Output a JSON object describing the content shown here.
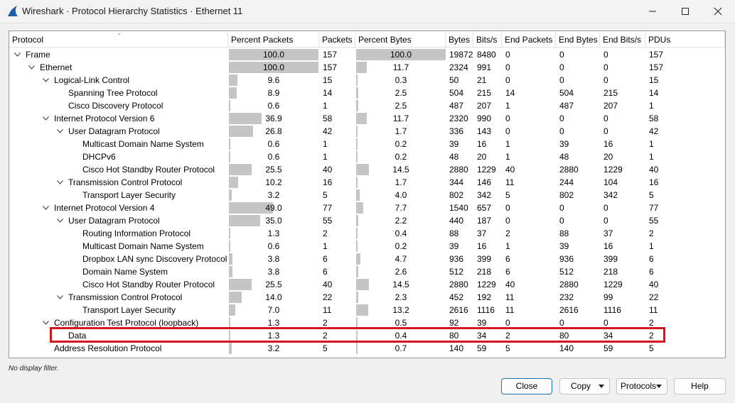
{
  "window": {
    "title": "Wireshark · Protocol Hierarchy Statistics · Ethernet 11",
    "icon": "wireshark-fin-icon",
    "controls": [
      "minimize-icon",
      "maximize-icon",
      "close-icon"
    ]
  },
  "table": {
    "columns": [
      "Protocol",
      "Percent Packets",
      "Packets",
      "Percent Bytes",
      "Bytes",
      "Bits/s",
      "End Packets",
      "End Bytes",
      "End Bits/s",
      "PDUs"
    ],
    "rows": [
      {
        "level": 0,
        "expandable": true,
        "name": "Frame",
        "pct_packets": "100.0",
        "packets": "157",
        "pct_bytes": "100.0",
        "bytes": "19872",
        "bits": "8480",
        "end_packets": "0",
        "end_bytes": "0",
        "end_bits": "0",
        "pdus": "157"
      },
      {
        "level": 1,
        "expandable": true,
        "name": "Ethernet",
        "pct_packets": "100.0",
        "packets": "157",
        "pct_bytes": "11.7",
        "bytes": "2324",
        "bits": "991",
        "end_packets": "0",
        "end_bytes": "0",
        "end_bits": "0",
        "pdus": "157"
      },
      {
        "level": 2,
        "expandable": true,
        "name": "Logical-Link Control",
        "pct_packets": "9.6",
        "packets": "15",
        "pct_bytes": "0.3",
        "bytes": "50",
        "bits": "21",
        "end_packets": "0",
        "end_bytes": "0",
        "end_bits": "0",
        "pdus": "15"
      },
      {
        "level": 3,
        "expandable": false,
        "name": "Spanning Tree Protocol",
        "pct_packets": "8.9",
        "packets": "14",
        "pct_bytes": "2.5",
        "bytes": "504",
        "bits": "215",
        "end_packets": "14",
        "end_bytes": "504",
        "end_bits": "215",
        "pdus": "14"
      },
      {
        "level": 3,
        "expandable": false,
        "name": "Cisco Discovery Protocol",
        "pct_packets": "0.6",
        "packets": "1",
        "pct_bytes": "2.5",
        "bytes": "487",
        "bits": "207",
        "end_packets": "1",
        "end_bytes": "487",
        "end_bits": "207",
        "pdus": "1"
      },
      {
        "level": 2,
        "expandable": true,
        "name": "Internet Protocol Version 6",
        "pct_packets": "36.9",
        "packets": "58",
        "pct_bytes": "11.7",
        "bytes": "2320",
        "bits": "990",
        "end_packets": "0",
        "end_bytes": "0",
        "end_bits": "0",
        "pdus": "58"
      },
      {
        "level": 3,
        "expandable": true,
        "name": "User Datagram Protocol",
        "pct_packets": "26.8",
        "packets": "42",
        "pct_bytes": "1.7",
        "bytes": "336",
        "bits": "143",
        "end_packets": "0",
        "end_bytes": "0",
        "end_bits": "0",
        "pdus": "42"
      },
      {
        "level": 4,
        "expandable": false,
        "name": "Multicast Domain Name System",
        "pct_packets": "0.6",
        "packets": "1",
        "pct_bytes": "0.2",
        "bytes": "39",
        "bits": "16",
        "end_packets": "1",
        "end_bytes": "39",
        "end_bits": "16",
        "pdus": "1"
      },
      {
        "level": 4,
        "expandable": false,
        "name": "DHCPv6",
        "pct_packets": "0.6",
        "packets": "1",
        "pct_bytes": "0.2",
        "bytes": "48",
        "bits": "20",
        "end_packets": "1",
        "end_bytes": "48",
        "end_bits": "20",
        "pdus": "1"
      },
      {
        "level": 4,
        "expandable": false,
        "name": "Cisco Hot Standby Router Protocol",
        "pct_packets": "25.5",
        "packets": "40",
        "pct_bytes": "14.5",
        "bytes": "2880",
        "bits": "1229",
        "end_packets": "40",
        "end_bytes": "2880",
        "end_bits": "1229",
        "pdus": "40"
      },
      {
        "level": 3,
        "expandable": true,
        "name": "Transmission Control Protocol",
        "pct_packets": "10.2",
        "packets": "16",
        "pct_bytes": "1.7",
        "bytes": "344",
        "bits": "146",
        "end_packets": "11",
        "end_bytes": "244",
        "end_bits": "104",
        "pdus": "16"
      },
      {
        "level": 4,
        "expandable": false,
        "name": "Transport Layer Security",
        "pct_packets": "3.2",
        "packets": "5",
        "pct_bytes": "4.0",
        "bytes": "802",
        "bits": "342",
        "end_packets": "5",
        "end_bytes": "802",
        "end_bits": "342",
        "pdus": "5"
      },
      {
        "level": 2,
        "expandable": true,
        "name": "Internet Protocol Version 4",
        "pct_packets": "49.0",
        "packets": "77",
        "pct_bytes": "7.7",
        "bytes": "1540",
        "bits": "657",
        "end_packets": "0",
        "end_bytes": "0",
        "end_bits": "0",
        "pdus": "77"
      },
      {
        "level": 3,
        "expandable": true,
        "name": "User Datagram Protocol",
        "pct_packets": "35.0",
        "packets": "55",
        "pct_bytes": "2.2",
        "bytes": "440",
        "bits": "187",
        "end_packets": "0",
        "end_bytes": "0",
        "end_bits": "0",
        "pdus": "55"
      },
      {
        "level": 4,
        "expandable": false,
        "name": "Routing Information Protocol",
        "pct_packets": "1.3",
        "packets": "2",
        "pct_bytes": "0.4",
        "bytes": "88",
        "bits": "37",
        "end_packets": "2",
        "end_bytes": "88",
        "end_bits": "37",
        "pdus": "2"
      },
      {
        "level": 4,
        "expandable": false,
        "name": "Multicast Domain Name System",
        "pct_packets": "0.6",
        "packets": "1",
        "pct_bytes": "0.2",
        "bytes": "39",
        "bits": "16",
        "end_packets": "1",
        "end_bytes": "39",
        "end_bits": "16",
        "pdus": "1"
      },
      {
        "level": 4,
        "expandable": false,
        "name": "Dropbox LAN sync Discovery Protocol",
        "pct_packets": "3.8",
        "packets": "6",
        "pct_bytes": "4.7",
        "bytes": "936",
        "bits": "399",
        "end_packets": "6",
        "end_bytes": "936",
        "end_bits": "399",
        "pdus": "6"
      },
      {
        "level": 4,
        "expandable": false,
        "name": "Domain Name System",
        "pct_packets": "3.8",
        "packets": "6",
        "pct_bytes": "2.6",
        "bytes": "512",
        "bits": "218",
        "end_packets": "6",
        "end_bytes": "512",
        "end_bits": "218",
        "pdus": "6"
      },
      {
        "level": 4,
        "expandable": false,
        "name": "Cisco Hot Standby Router Protocol",
        "pct_packets": "25.5",
        "packets": "40",
        "pct_bytes": "14.5",
        "bytes": "2880",
        "bits": "1229",
        "end_packets": "40",
        "end_bytes": "2880",
        "end_bits": "1229",
        "pdus": "40"
      },
      {
        "level": 3,
        "expandable": true,
        "name": "Transmission Control Protocol",
        "pct_packets": "14.0",
        "packets": "22",
        "pct_bytes": "2.3",
        "bytes": "452",
        "bits": "192",
        "end_packets": "11",
        "end_bytes": "232",
        "end_bits": "99",
        "pdus": "22"
      },
      {
        "level": 4,
        "expandable": false,
        "name": "Transport Layer Security",
        "pct_packets": "7.0",
        "packets": "11",
        "pct_bytes": "13.2",
        "bytes": "2616",
        "bits": "1116",
        "end_packets": "11",
        "end_bytes": "2616",
        "end_bits": "1116",
        "pdus": "11"
      },
      {
        "level": 2,
        "expandable": true,
        "name": "Configuration Test Protocol (loopback)",
        "pct_packets": "1.3",
        "packets": "2",
        "pct_bytes": "0.5",
        "bytes": "92",
        "bits": "39",
        "end_packets": "0",
        "end_bytes": "0",
        "end_bits": "0",
        "pdus": "2"
      },
      {
        "level": 3,
        "expandable": false,
        "name": "Data",
        "highlighted": true,
        "pct_packets": "1.3",
        "packets": "2",
        "pct_bytes": "0.4",
        "bytes": "80",
        "bits": "34",
        "end_packets": "2",
        "end_bytes": "80",
        "end_bits": "34",
        "pdus": "2"
      },
      {
        "level": 2,
        "expandable": false,
        "name": "Address Resolution Protocol",
        "pct_packets": "3.2",
        "packets": "5",
        "pct_bytes": "0.7",
        "bytes": "140",
        "bits": "59",
        "end_packets": "5",
        "end_bytes": "140",
        "end_bits": "59",
        "pdus": "5"
      }
    ]
  },
  "status_text": "No display filter.",
  "buttons": {
    "close": "Close",
    "copy": "Copy",
    "protocols": "Protocols",
    "help": "Help"
  },
  "colors": {
    "bar_fill": "#c5c5c5",
    "highlight_border": "#d7151c",
    "primary_button_border": "#1b6fb5"
  }
}
